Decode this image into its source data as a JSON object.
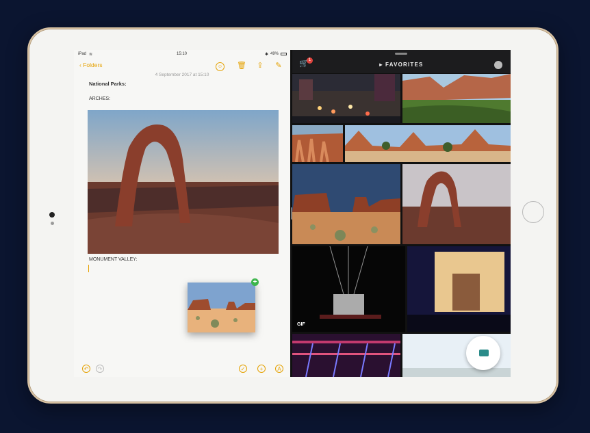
{
  "notes": {
    "status": {
      "device": "iPad",
      "time": "15:10",
      "battery": "49%"
    },
    "toolbar": {
      "back_label": "Folders"
    },
    "date": "4 September 2017 at 15:10",
    "heading": "National Parks:",
    "section1": "ARCHES:",
    "section2": "MONUMENT VALLEY:",
    "accent_color": "#e5a100"
  },
  "photos": {
    "title": "FAVORITES",
    "cart_badge": "1",
    "gif_label": "GIF"
  },
  "icons": [
    "wifi-icon",
    "bluetooth-icon",
    "battery-icon",
    "share-people-icon",
    "trash-icon",
    "share-icon",
    "compose-icon",
    "undo-icon",
    "redo-icon",
    "checklist-icon",
    "add-icon",
    "markup-icon",
    "cart-icon",
    "camera-icon",
    "add-badge-icon"
  ]
}
